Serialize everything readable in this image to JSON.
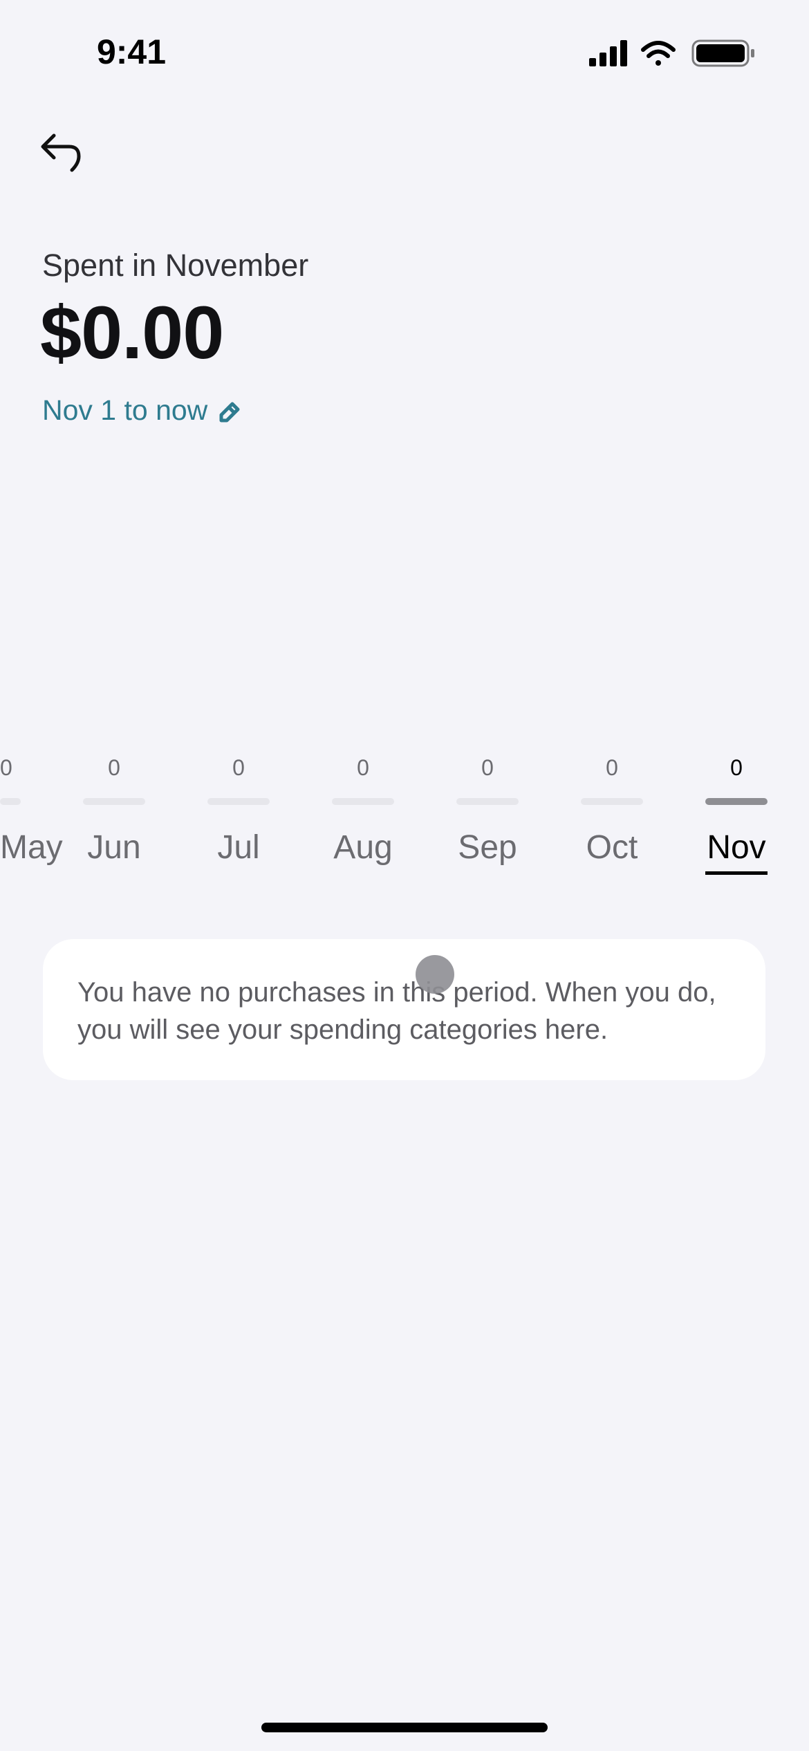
{
  "status_bar": {
    "time": "9:41",
    "icons": [
      "cellular-signal-icon",
      "wifi-icon",
      "battery-icon"
    ]
  },
  "header": {
    "back_icon": "back-arrow-icon",
    "subtitle": "Spent in November",
    "amount": "$0.00",
    "range": "Nov 1 to now",
    "range_icon": "pencil-icon"
  },
  "colors": {
    "accent": "#2e7b8f",
    "selected_bar": "#8e8e93",
    "bar": "#e6e6eb"
  },
  "months": [
    {
      "label": "May",
      "value": "0"
    },
    {
      "label": "Jun",
      "value": "0"
    },
    {
      "label": "Jul",
      "value": "0"
    },
    {
      "label": "Aug",
      "value": "0"
    },
    {
      "label": "Sep",
      "value": "0"
    },
    {
      "label": "Oct",
      "value": "0"
    },
    {
      "label": "Nov",
      "value": "0",
      "selected": true
    }
  ],
  "empty_message": "You have no purchases in this period. When you do, you will see your spending categories here."
}
